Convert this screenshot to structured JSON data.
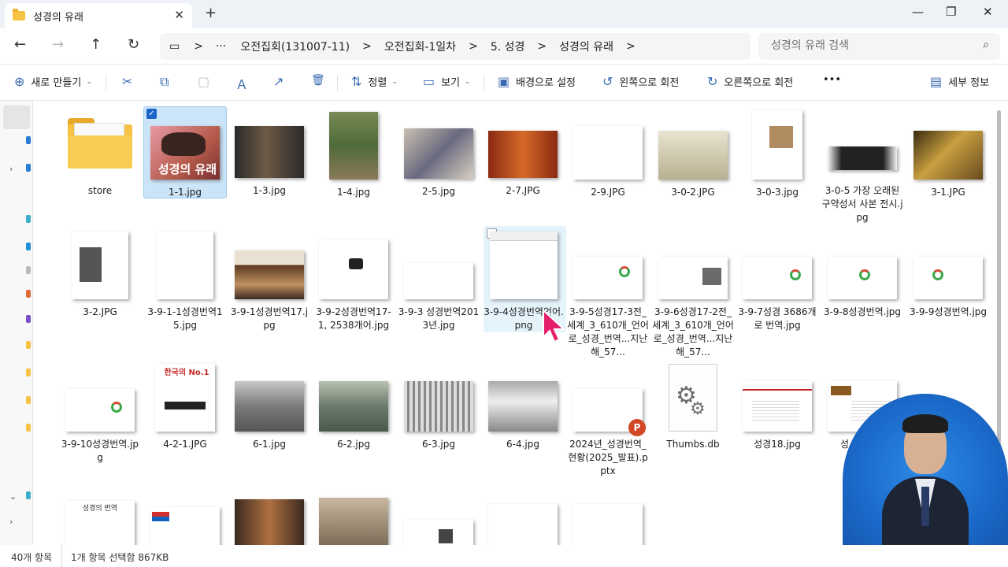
{
  "window": {
    "tab_title": "성경의 유래",
    "tab_close": "✕",
    "new_tab": "+",
    "minimize": "—",
    "maximize": "❐",
    "close": "✕"
  },
  "nav": {
    "back": "←",
    "forward": "→",
    "up": "↑",
    "refresh": "↻"
  },
  "breadcrumb": {
    "computer_icon": "▭",
    "more": "···",
    "separator": ">",
    "items": [
      "오전집회(131007-11)",
      "오전집회-1일차",
      "5. 성경",
      "성경의 유래"
    ]
  },
  "search": {
    "placeholder": "성경의 유래 검색",
    "icon": "⌕"
  },
  "commands": {
    "new": "새로 만들기",
    "sort": "정렬",
    "view": "보기",
    "set_background": "배경으로 설정",
    "rotate_left": "왼쪽으로 회전",
    "rotate_right": "오른쪽으로 회전",
    "more": "•••",
    "details": "세부 정보",
    "icons": {
      "new": "⊕",
      "cut": "✂",
      "copy": "⧉",
      "paste": "▢",
      "rename": "Ａ",
      "share": "↗",
      "delete": "🗑",
      "sort": "⇅",
      "view": "▭",
      "background": "▣",
      "rotate_left": "↺",
      "rotate_right": "↻",
      "details": "▤"
    }
  },
  "files": {
    "store": "store",
    "f1_1": "1-1.jpg",
    "f1_1_text": "성경의 유래",
    "f1_3": "1-3.jpg",
    "f1_4": "1-4.jpg",
    "f2_5": "2-5.jpg",
    "f2_7": "2-7.JPG",
    "f2_9": "2-9.JPG",
    "f3_0_2": "3-0-2.JPG",
    "f3_0_3": "3-0-3.jpg",
    "f3_0_5": "3-0-5 가장 오래된 구약성서 사본 전시.jpg",
    "f3_1": "3-1.JPG",
    "f3_2": "3-2.JPG",
    "f3_9_1_1": "3-9-1-1성경번역15.jpg",
    "f3_9_1": "3-9-1성경번역17.jpg",
    "f3_9_2": "3-9-2성경번역17-1, 2538개어.jpg",
    "f3_9_3": "3-9-3 성경번역2013년.jpg",
    "f3_9_4": "3-9-4성경번역언어.png",
    "f3_9_5": "3-9-5성경17-3전_세계_3_610개_언어로_성경_번역...지난해_57...",
    "f3_9_6": "3-9-6성경17-2전_세계_3_610개_언어로_성경_번역...지난해_57...",
    "f3_9_7": "3-9-7성경 3686개로 번역.jpg",
    "f3_9_8": "3-9-8성경번역.jpg",
    "f3_9_9": "3-9-9성경번역.jpg",
    "f3_9_10": "3-9-10성경번역.jpg",
    "f4_2_1": "4-2-1.JPG",
    "f4_2_1_title": "한국의 No.1",
    "f6_1": "6-1.jpg",
    "f6_2": "6-2.jpg",
    "f6_3": "6-3.jpg",
    "f6_4": "6-4.jpg",
    "f2024": "2024년_성경번역_현황(2025_발표).pptx",
    "thumbs": "Thumbs.db",
    "f18": "성경18.jpg",
    "f19_partial": "성",
    "row4_title": "성경의 번역"
  },
  "status": {
    "count": "40개 항목",
    "selected": "1개 항목 선택함 867KB"
  }
}
